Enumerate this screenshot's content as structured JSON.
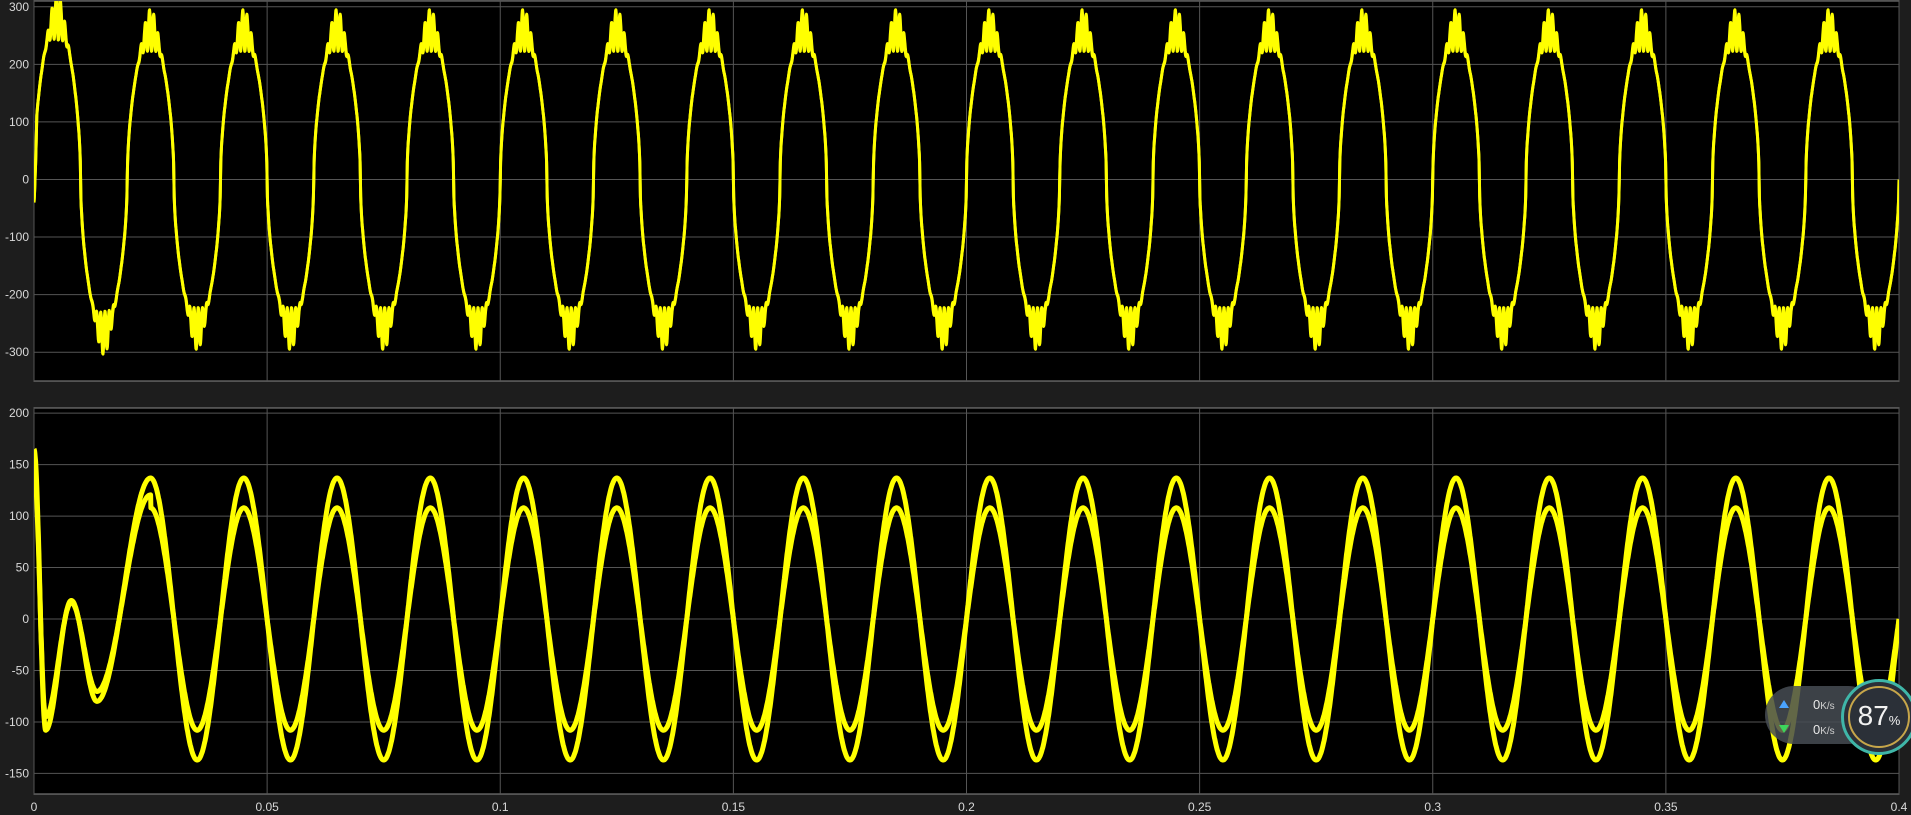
{
  "chart_data": [
    {
      "type": "line",
      "title": "",
      "xlabel": "",
      "ylabel": "",
      "xlim": [
        0,
        0.4
      ],
      "ylim": [
        -350,
        310
      ],
      "x_ticks": [
        "0",
        "0.05",
        "0.1",
        "0.15",
        "0.2",
        "0.25",
        "0.3",
        "0.35",
        "0.4"
      ],
      "x_tick_labels_shown": false,
      "y_ticks": [
        300,
        200,
        100,
        0,
        -100,
        -200,
        -300
      ],
      "y_tick_labels": [
        "300",
        "200",
        "100",
        "0",
        "-100",
        "-200",
        "-300"
      ],
      "grid": true,
      "series": [
        {
          "color": "#ffff00",
          "frequency_hz": 50,
          "steady_amplitude_peak": 250,
          "initial_peak_first_cycle": 290,
          "notches_near_peaks": true,
          "start_value": -40
        }
      ]
    },
    {
      "type": "line",
      "title": "",
      "xlabel": "",
      "ylabel": "",
      "xlim": [
        0,
        0.4
      ],
      "ylim": [
        -170,
        205
      ],
      "x_ticks": [
        "0",
        "0.05",
        "0.1",
        "0.15",
        "0.2",
        "0.25",
        "0.3",
        "0.35",
        "0.4"
      ],
      "x_tick_labels": [
        "0",
        "0.05",
        "0.1",
        "0.15",
        "0.2",
        "0.25",
        "0.3",
        "0.35",
        "0.4"
      ],
      "y_ticks": [
        200,
        150,
        100,
        50,
        0,
        -50,
        -100,
        -150
      ],
      "y_tick_labels": [
        "200",
        "150",
        "100",
        "50",
        "0",
        "-50",
        "-100",
        "-150"
      ],
      "grid": true,
      "series": [
        {
          "color": "#ffff00",
          "frequency_hz": 50,
          "steady_peak_outer": 137,
          "steady_peak_inner": 108,
          "transient_points": [
            [
              0,
              165
            ],
            [
              0.0025,
              -108
            ],
            [
              0.008,
              18
            ],
            [
              0.0135,
              -80
            ],
            [
              0.025,
              137
            ]
          ]
        }
      ]
    }
  ],
  "network_widget": {
    "upload_value": "0",
    "upload_unit": "K/s",
    "download_value": "0",
    "download_unit": "K/s",
    "cpu_value": "87",
    "cpu_unit": "%"
  }
}
